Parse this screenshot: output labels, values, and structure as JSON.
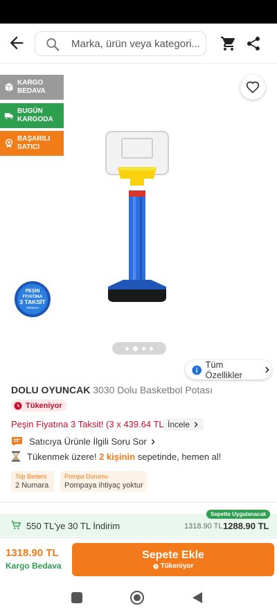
{
  "search": {
    "placeholder": "Marka, ürün veya kategori..."
  },
  "badges": [
    {
      "label": "KARGO BEDAVA",
      "icon": "box-icon",
      "color": "#9a9a9a"
    },
    {
      "label": "BUGÜN KARGODA",
      "icon": "truck-icon",
      "color": "#2e9e4f"
    },
    {
      "label": "BAŞARILI SATICI",
      "icon": "medal-icon",
      "color": "#f07d18"
    }
  ],
  "gallery": {
    "image_count": 4,
    "active_index": 1,
    "sticker_lines": [
      "PEŞİN",
      "FİYATINA",
      "3 TAKSİT",
      "FIRSATI"
    ]
  },
  "features_button": "Tüm Özellikler",
  "product": {
    "brand": "DOLU OYUNCAK",
    "name": "3030 Dolu Basketbol Potası",
    "stock_status": "Tükeniyor",
    "installment_text": "Peşin Fiyatına 3 Taksit! (3 x 439.64 TL)",
    "inspect_label": "İncele",
    "ask_seller": "Satıcıya Ürünle İlgili Soru Sor",
    "urgency_prefix": "Tükenmek üzere!",
    "urgency_count": "2 kişinin",
    "urgency_suffix": "sepetinde, hemen al!"
  },
  "attributes": [
    {
      "label": "Top Bedeni",
      "value": "2 Numara"
    },
    {
      "label": "Pompa Durumu",
      "value": "Pompaya ihtiyaç yoktur"
    }
  ],
  "discount": {
    "pill": "Sepette Uygulanacak",
    "text": "550 TL'ye 30 TL İndirim",
    "old_price": "1318.90 TL",
    "new_price": "1288.90 TL"
  },
  "footer": {
    "price": "1318.90 TL",
    "shipping": "Kargo Bedava",
    "button_label": "Sepete Ekle",
    "button_sub": "Tükeniyor"
  },
  "colors": {
    "brand_orange": "#f27a1a",
    "green": "#2e9e4f",
    "red": "#c8102e"
  }
}
